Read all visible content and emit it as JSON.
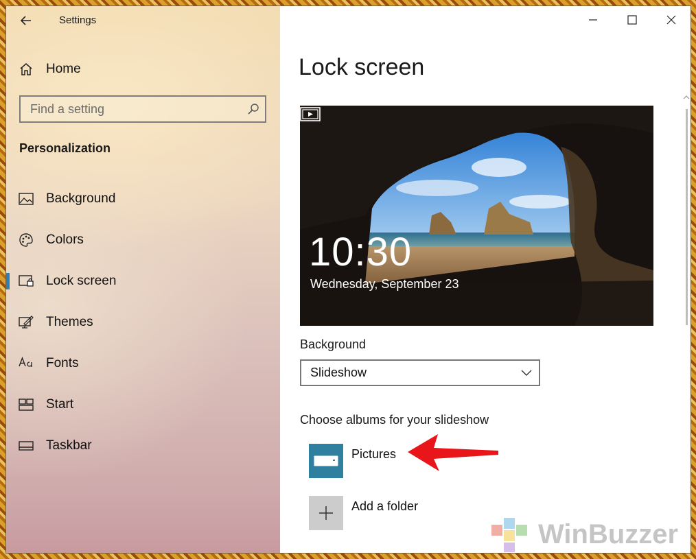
{
  "window": {
    "title": "Settings"
  },
  "sidebar": {
    "home_label": "Home",
    "search_placeholder": "Find a setting",
    "section_title": "Personalization",
    "items": [
      {
        "label": "Background",
        "icon": "picture-icon",
        "active": false
      },
      {
        "label": "Colors",
        "icon": "palette-icon",
        "active": false
      },
      {
        "label": "Lock screen",
        "icon": "lock-screen-icon",
        "active": true
      },
      {
        "label": "Themes",
        "icon": "themes-icon",
        "active": false
      },
      {
        "label": "Fonts",
        "icon": "fonts-icon",
        "active": false
      },
      {
        "label": "Start",
        "icon": "start-icon",
        "active": false
      },
      {
        "label": "Taskbar",
        "icon": "taskbar-icon",
        "active": false
      }
    ]
  },
  "main": {
    "page_title": "Lock screen",
    "preview": {
      "time": "10:30",
      "date": "Wednesday, September 23"
    },
    "background_label": "Background",
    "background_value": "Slideshow",
    "albums_label": "Choose albums for your slideshow",
    "albums": [
      {
        "name": "Pictures"
      },
      {
        "name": "Add a folder"
      }
    ]
  },
  "watermark": {
    "text": "WinBuzzer"
  },
  "colors": {
    "accent": "#2d7fb4",
    "album_tile": "#2f7f9e",
    "annotation_arrow": "#e8161a"
  }
}
